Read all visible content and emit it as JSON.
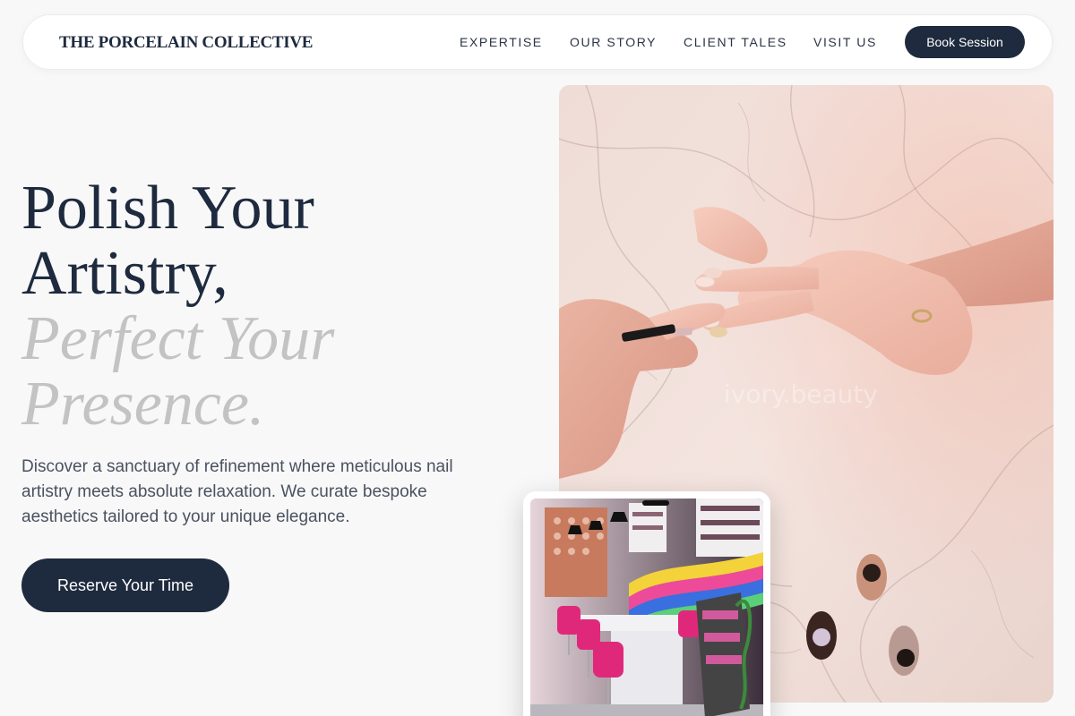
{
  "nav": {
    "brand": "THE PORCELAIN COLLECTIVE",
    "links": [
      {
        "label": "EXPERTISE"
      },
      {
        "label": "OUR STORY"
      },
      {
        "label": "CLIENT TALES"
      },
      {
        "label": "VISIT US"
      }
    ],
    "cta_label": "Book Session"
  },
  "hero": {
    "headline_line1": "Polish Your",
    "headline_line2": "Artistry,",
    "headline_line3": "Perfect Your",
    "headline_line4": "Presence.",
    "description": "Discover a sanctuary of refinement where meticulous nail artistry meets absolute relaxation. We curate bespoke aesthetics tailored to your unique elegance.",
    "cta_label": "Reserve Your Time"
  },
  "images": {
    "main_watermark": "ivory.beauty"
  },
  "colors": {
    "primary": "#1e2a3e",
    "background": "#f8f8f8",
    "headline_accent": "#c3c3c3",
    "body_text": "#4a5160"
  }
}
